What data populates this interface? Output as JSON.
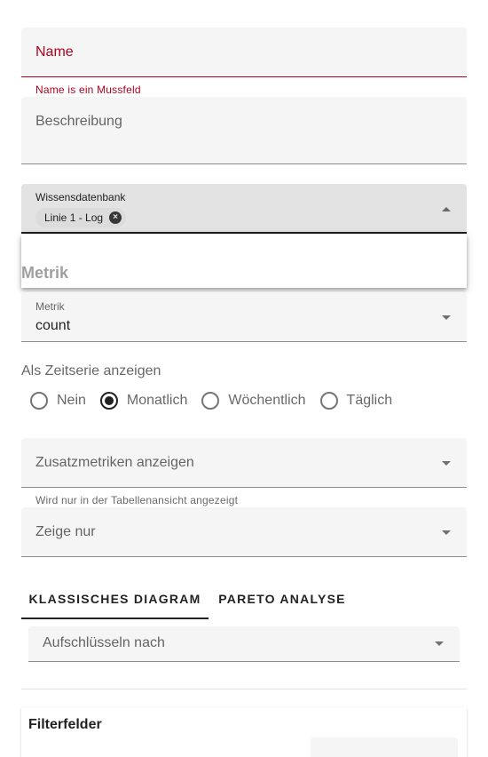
{
  "form": {
    "name": {
      "placeholder": "Name",
      "error": "Name is ein Mussfeld"
    },
    "beschreibung": {
      "placeholder": "Beschreibung"
    },
    "wissensdatenbank": {
      "label": "Wissensdatenbank",
      "chips": [
        "Linie 1 - Log"
      ]
    },
    "dropdown": {
      "group_label": "Metrik"
    },
    "metrik": {
      "label": "Metrik",
      "value": "count"
    },
    "zeitserie": {
      "label": "Als Zeitserie anzeigen",
      "options": [
        {
          "label": "Nein",
          "checked": false
        },
        {
          "label": "Monatlich",
          "checked": true
        },
        {
          "label": "Wöchentlich",
          "checked": false
        },
        {
          "label": "Täglich",
          "checked": false
        }
      ]
    },
    "zusatzmetriken": {
      "placeholder": "Zusatzmetriken anzeigen",
      "hint": "Wird nur in der Tabellenansicht angezeigt"
    },
    "zeige_nur": {
      "placeholder": "Zeige nur"
    },
    "tabs": [
      {
        "label": "Klassisches Diagram",
        "active": true
      },
      {
        "label": "Pareto Analyse",
        "active": false
      }
    ],
    "aufschluesseln": {
      "placeholder": "Aufschlüsseln nach"
    },
    "filterfelder": {
      "title": "Filterfelder"
    }
  },
  "colors": {
    "error": "#b00020",
    "field_bg": "#f5f5f5",
    "field_focus_bg": "#e3e3e3"
  }
}
